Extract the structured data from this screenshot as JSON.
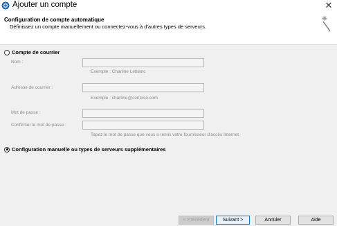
{
  "window": {
    "title": "Ajouter un compte",
    "close_glyph": "✕"
  },
  "header": {
    "title": "Configuration de compte automatique",
    "subtitle": "Définissez un compte manuellement ou connectez-vous à d'autres types de serveurs.",
    "icon": "wizard-sparkle-icon"
  },
  "options": {
    "email_account": {
      "label": "Compte de courrier",
      "selected": false
    },
    "manual": {
      "label": "Configuration manuelle ou types de serveurs supplémentaires",
      "selected": true
    }
  },
  "fields": {
    "name": {
      "label": "Nom :",
      "value": "",
      "hint": "Exemple : Charline Leblanc"
    },
    "email": {
      "label": "Adresse de courrier :",
      "value": "",
      "hint": "Exemple : charline@contoso.com"
    },
    "password": {
      "label": "Mot de passe :",
      "value": ""
    },
    "confirm_password": {
      "label": "Confirmer le mot de passe :",
      "value": ""
    },
    "password_hint": "Tapez le mot de passe que vous a remis votre fournisseur d'accès Internet."
  },
  "buttons": {
    "previous": "< Précédent",
    "next": "Suivant >",
    "cancel": "Annuler",
    "help": "Aide"
  }
}
